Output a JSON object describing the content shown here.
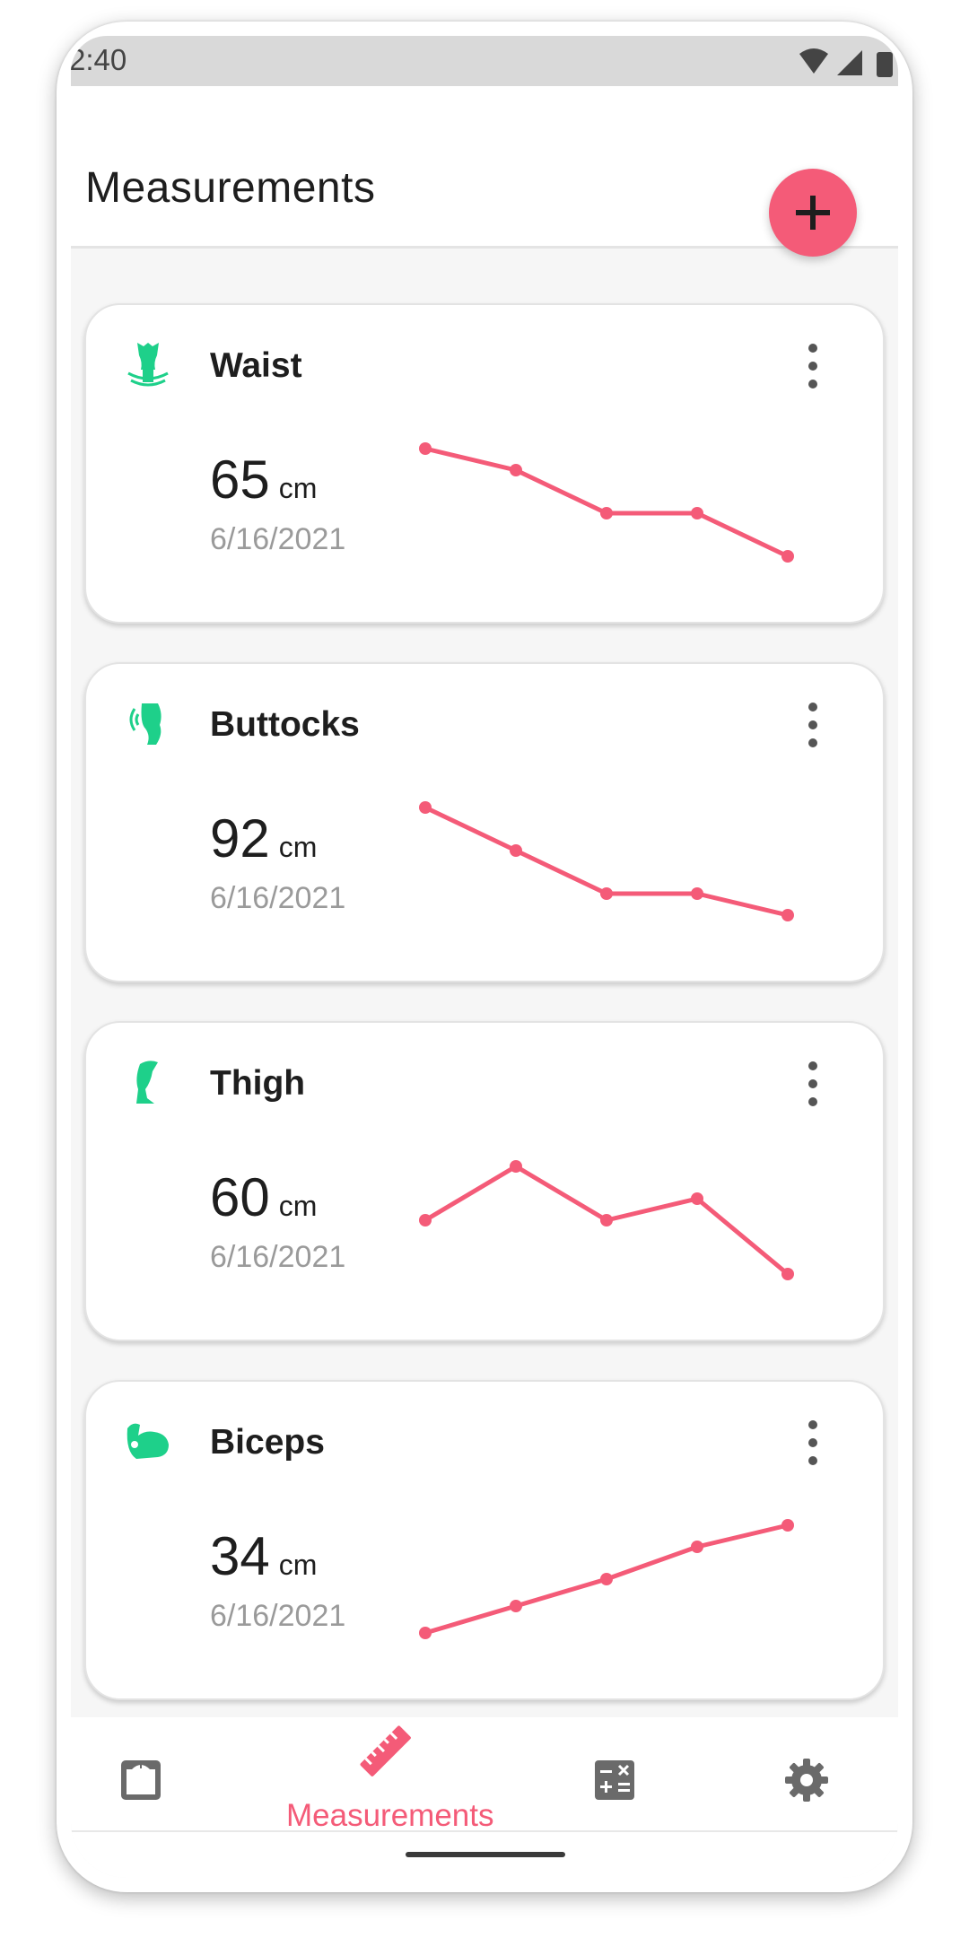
{
  "status_bar": {
    "time": "2:40"
  },
  "app_bar": {
    "title": "Measurements",
    "add_icon": "plus-icon"
  },
  "colors": {
    "accent": "#f45b78",
    "icon_green": "#1ed08a",
    "card_bg": "#ffffff",
    "screen_bg": "#f6f6f6"
  },
  "cards": [
    {
      "title": "Waist",
      "value": "65",
      "unit": "cm",
      "date": "6/16/2021",
      "icon": "waist-icon",
      "trend": [
        65.8,
        65.6,
        65.2,
        65.2,
        64.8
      ]
    },
    {
      "title": "Buttocks",
      "value": "92",
      "unit": "cm",
      "date": "6/16/2021",
      "icon": "buttocks-icon",
      "trend": [
        93.8,
        93.4,
        93.0,
        93.0,
        92.8
      ]
    },
    {
      "title": "Thigh",
      "value": "60",
      "unit": "cm",
      "date": "6/16/2021",
      "icon": "thigh-icon",
      "trend": [
        60.5,
        61.0,
        60.5,
        60.7,
        60.0
      ]
    },
    {
      "title": "Biceps",
      "value": "34",
      "unit": "cm",
      "date": "6/16/2021",
      "icon": "biceps-icon",
      "trend": [
        33.0,
        33.25,
        33.5,
        33.8,
        34.0
      ]
    }
  ],
  "bottom_nav": {
    "items": [
      {
        "id": "weight",
        "icon": "scale-icon"
      },
      {
        "id": "measurements",
        "label": "Measurements",
        "icon": "ruler-icon",
        "active": true
      },
      {
        "id": "calculator",
        "icon": "calculator-icon"
      },
      {
        "id": "settings",
        "icon": "gear-icon"
      }
    ]
  }
}
